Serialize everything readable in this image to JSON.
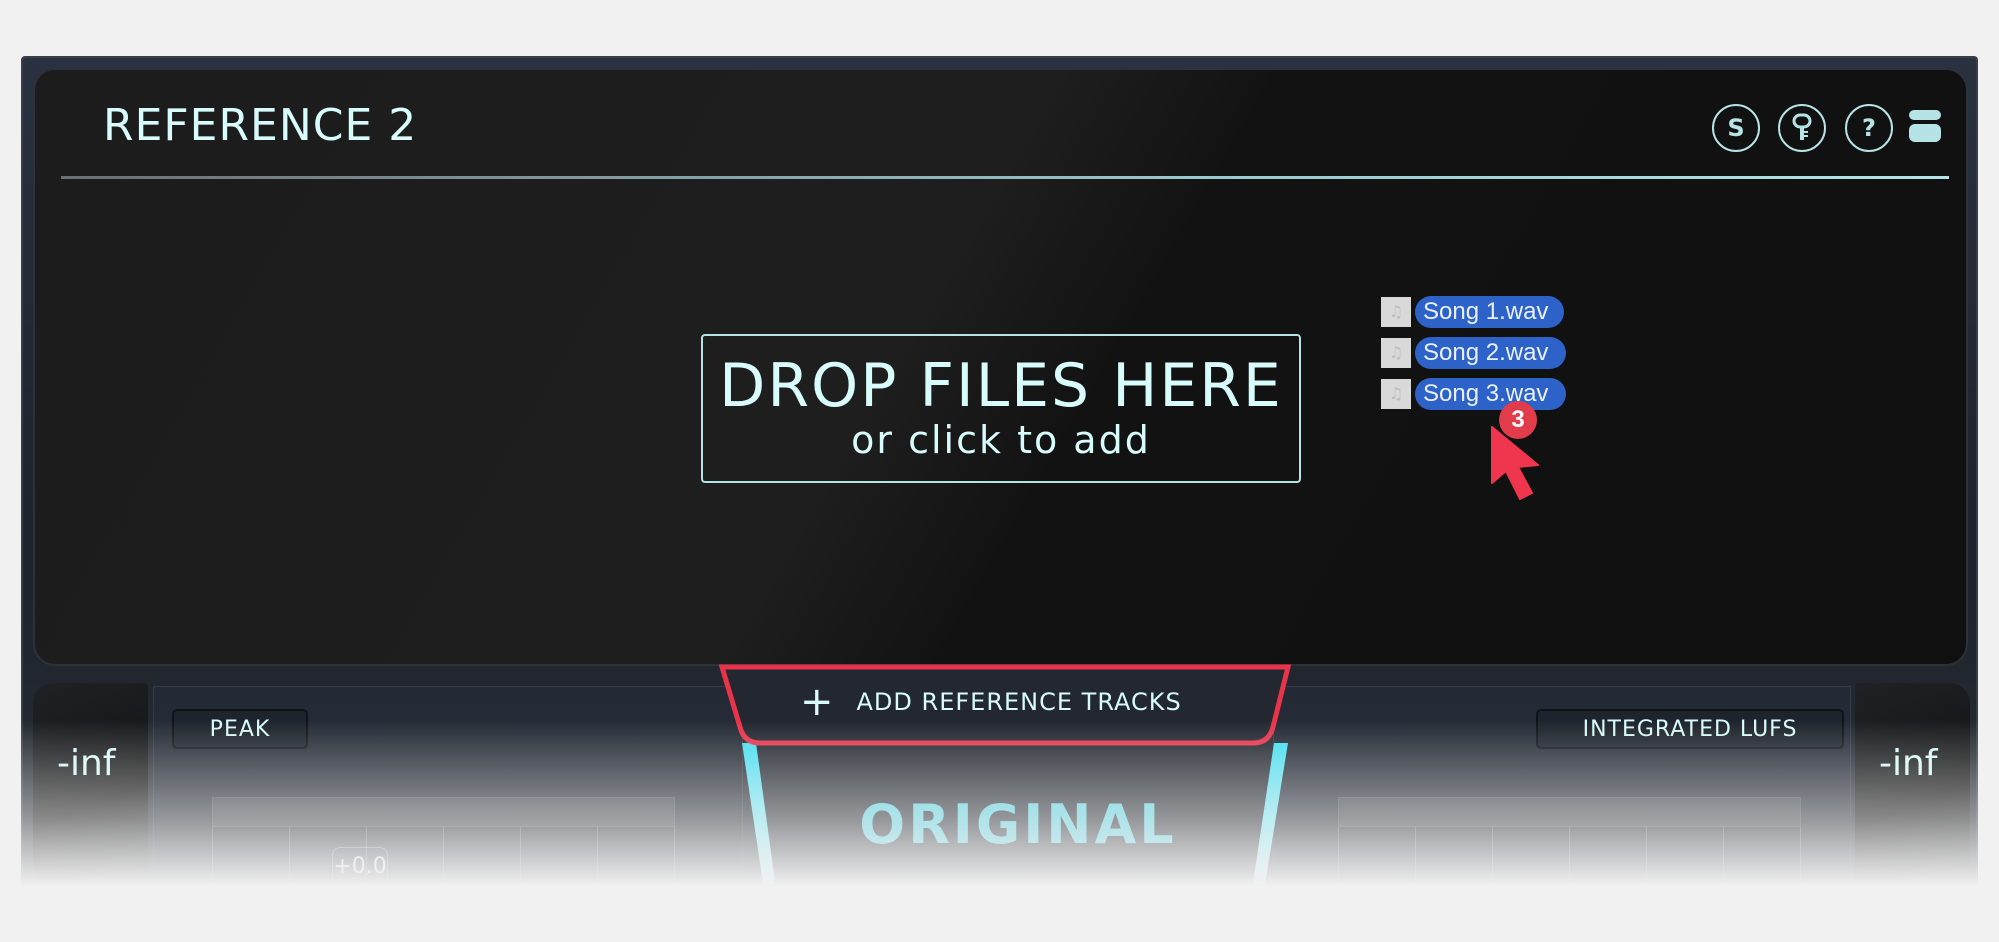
{
  "header": {
    "title": "REFERENCE 2",
    "icons": [
      {
        "name": "s-icon",
        "glyph": "S"
      },
      {
        "name": "key-icon",
        "glyph": "key"
      },
      {
        "name": "help-icon",
        "glyph": "?"
      },
      {
        "name": "layout-icon",
        "glyph": "layout"
      }
    ]
  },
  "drop_zone": {
    "title": "DROP FILES HERE",
    "subtitle": "or click to add"
  },
  "dragged_files": {
    "files": [
      "Song 1.wav",
      "Song 2.wav",
      "Song 3.wav"
    ],
    "count_badge": "3",
    "file_icon": "music-note-icon"
  },
  "meters": {
    "left": {
      "label": "PEAK",
      "value": "-inf",
      "readout": "+0.0"
    },
    "right": {
      "label": "INTEGRATED LUFS",
      "value": "-inf"
    }
  },
  "center": {
    "add_button_label": "ADD REFERENCE TRACKS",
    "add_icon": "+",
    "mode_label": "ORIGINAL"
  },
  "colors": {
    "accent": "#b6e3e6",
    "text": "#d8fbfb",
    "highlight": "#e8344b",
    "cyan": "#46dff0",
    "file_pill": "#2d63c9",
    "badge": "#e23b4a"
  }
}
